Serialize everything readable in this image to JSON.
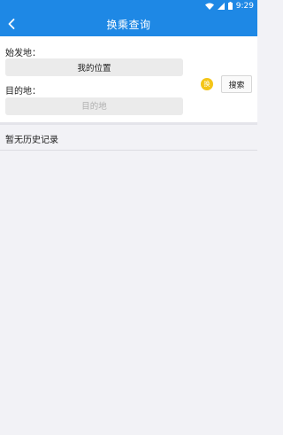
{
  "status_bar": {
    "time": "9:29",
    "icons": [
      "wifi-icon",
      "signal-icon",
      "battery-icon"
    ]
  },
  "app_bar": {
    "title": "换乘查询",
    "back_icon": "chevron-left-icon"
  },
  "form": {
    "origin_label": "始发地：",
    "origin_value": "我的位置",
    "destination_label": "目的地：",
    "destination_placeholder": "目的地",
    "swap_text": "换",
    "search_label": "搜索"
  },
  "history": {
    "empty_text": "暂无历史记录"
  },
  "colors": {
    "primary": "#1e88e5",
    "swap_accent": "#f4c518",
    "background": "#f2f2f6"
  }
}
